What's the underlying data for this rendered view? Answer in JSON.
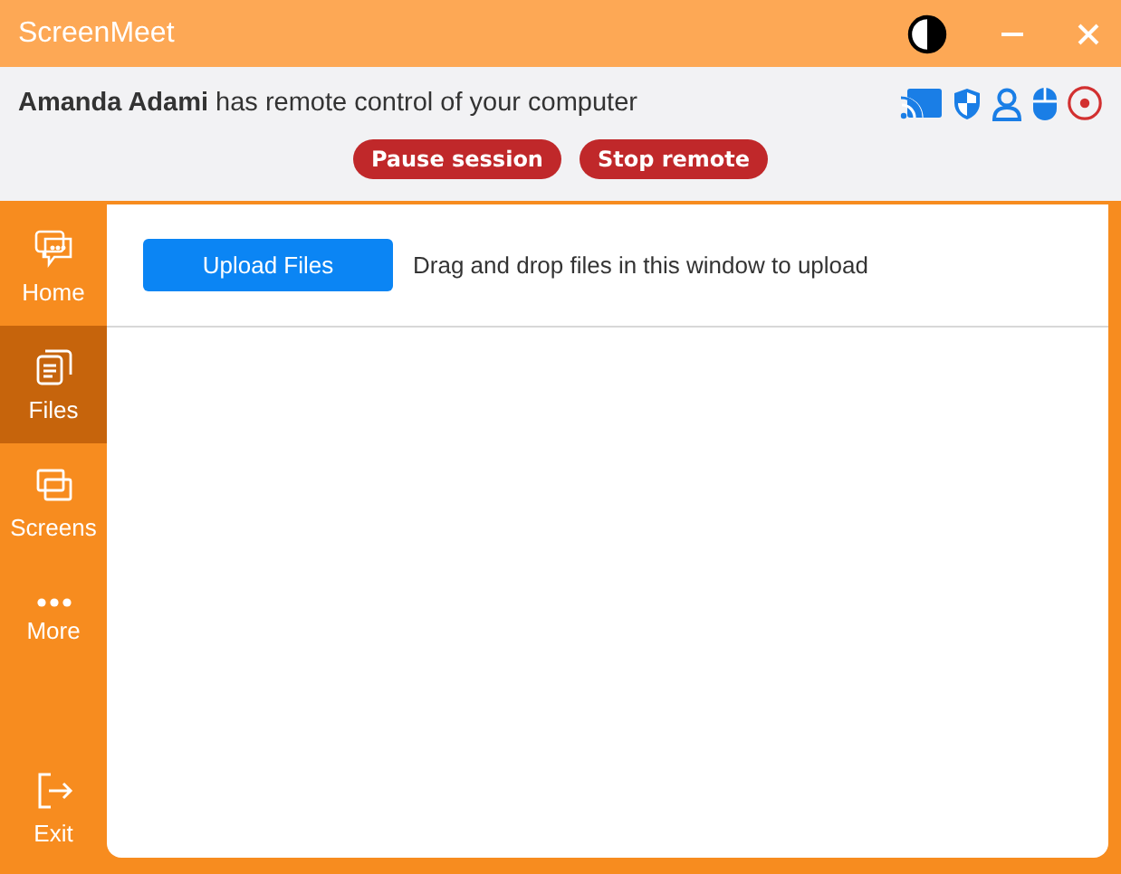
{
  "window": {
    "title": "ScreenMeet"
  },
  "session": {
    "message": "**Amanda Adami** has remote control of your computer",
    "buttons": [
      "Pause session",
      "Stop remote"
    ]
  },
  "sidebar": {
    "items": [
      {
        "label": "Home",
        "kind": "chat",
        "selected": false
      },
      {
        "label": "Files",
        "kind": "files",
        "selected": true
      },
      {
        "label": "Screens",
        "kind": "screens",
        "selected": false
      },
      {
        "label": "More",
        "kind": "more",
        "selected": false
      }
    ],
    "exit": {
      "label": "Exit"
    }
  },
  "files": {
    "upload_button": "Upload Files",
    "hint": "Drag and drop files in this window to upload"
  }
}
